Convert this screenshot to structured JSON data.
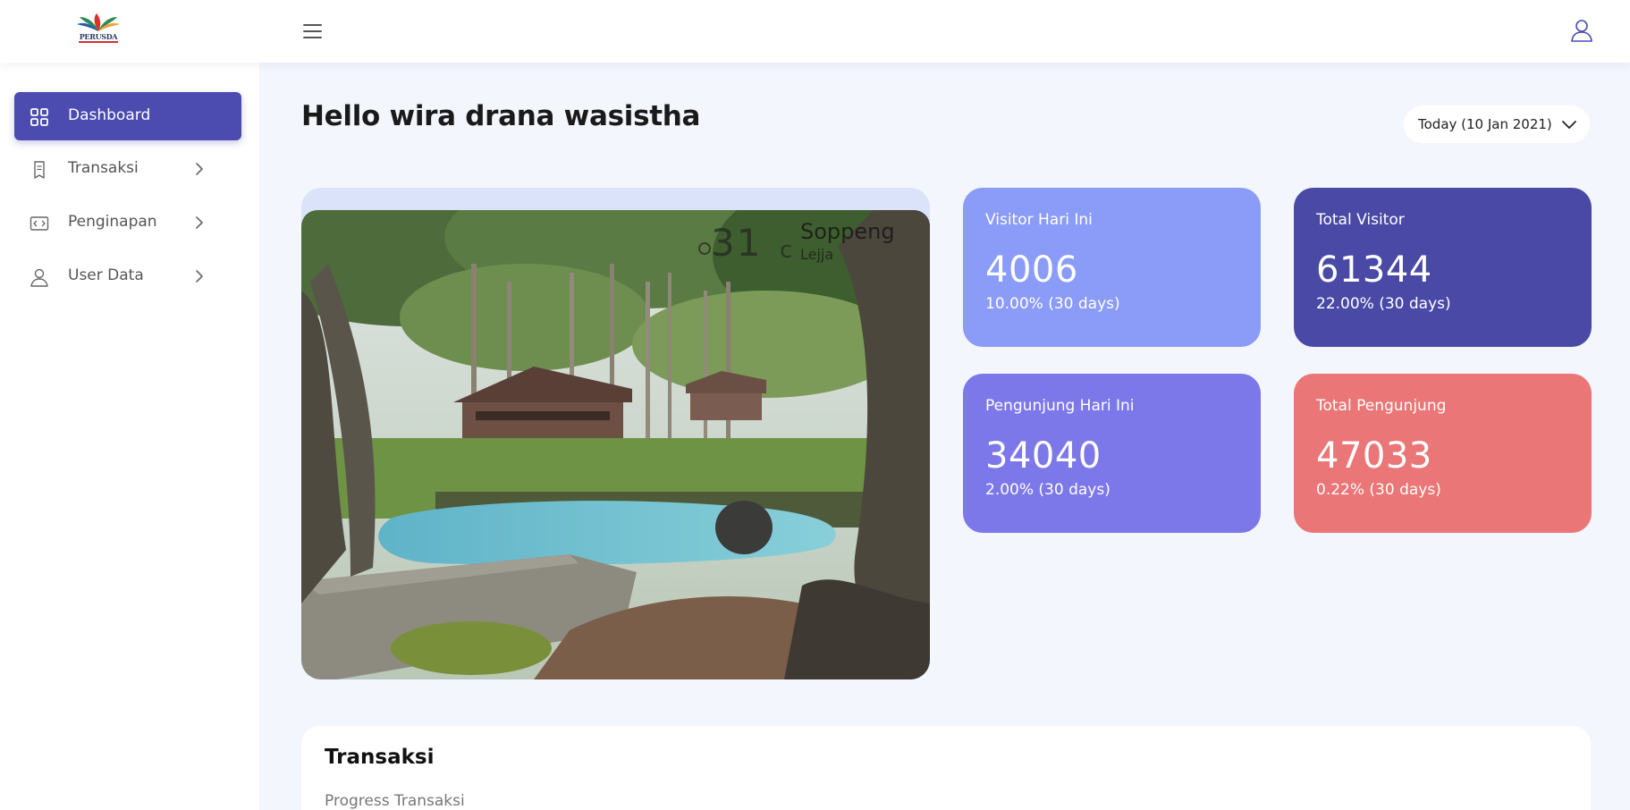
{
  "header": {
    "logo_text": "PERUSDA",
    "menu_icon": "hamburger-menu-icon",
    "user_icon": "user-icon"
  },
  "sidebar": {
    "items": [
      {
        "label": "Dashboard",
        "icon": "grid-icon",
        "active": true
      },
      {
        "label": "Transaksi",
        "icon": "receipt-icon",
        "active": false
      },
      {
        "label": "Penginapan",
        "icon": "code-icon",
        "active": false
      },
      {
        "label": "User Data",
        "icon": "user-icon",
        "active": false
      }
    ]
  },
  "main": {
    "greeting": "Hello wira drana wasistha",
    "date_filter": "Today (10 Jan 2021)",
    "weather": {
      "temp": "31",
      "unit": "c",
      "city": "Soppeng",
      "sub": "Lejja"
    },
    "stats": [
      {
        "title": "Visitor Hari Ini",
        "value": "4006",
        "change": "10.00% (30 days)",
        "color": "#8b9cf8"
      },
      {
        "title": "Total Visitor",
        "value": "61344",
        "change": "22.00% (30 days)",
        "color": "#4a4aa6"
      },
      {
        "title": "Pengunjung Hari Ini",
        "value": "34040",
        "change": "2.00% (30 days)",
        "color": "#7d78ea"
      },
      {
        "title": "Total Pengunjung",
        "value": "47033",
        "change": "0.22% (30 days)",
        "color": "#ea7677"
      }
    ],
    "transaksi": {
      "title": "Transaksi",
      "subtitle": "Progress Transaksi"
    }
  }
}
